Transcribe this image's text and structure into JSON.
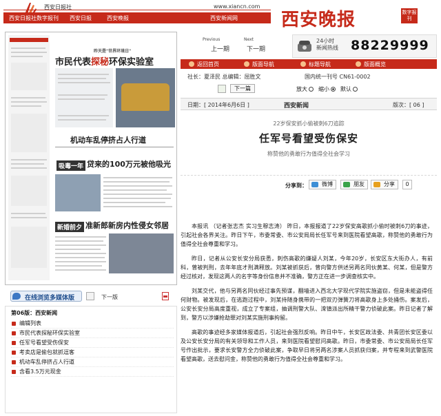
{
  "header": {
    "brand_small": "西安日报社",
    "url": "www.xiancn.com",
    "nav": [
      "西安日报社数字报刊",
      "西安日报",
      "西安晚报",
      "西安新闻网"
    ],
    "brand_title": "西安晚报",
    "brand_badge": "数字报刊",
    "accent_color": "#c62a1a"
  },
  "left_page": {
    "kicker": "昨天是\"世界环境日\"",
    "headline_main_a": "市民代表",
    "headline_main_accent": "探秘",
    "headline_main_b": "环保实验室",
    "headline_2": "机动车乱停挤占人行道",
    "headline_3_tag": "吸毒一年",
    "headline_3": "贷来的100万元被他吸光",
    "headline_4_tag": "新婚前夕",
    "headline_4": "准新郎新房内性侵女邻居"
  },
  "media_bar": {
    "media_label": "在线浏览多媒体版",
    "next_page": "下一版",
    "pdf_icon": "pdf-icon"
  },
  "toc": {
    "section": "第06版：西安新闻",
    "items": [
      "编辑列表",
      "市民代表探秘环保实验室",
      "任军号看望受伤保安",
      "考卖店是偷包就抓逗客",
      "机动车乱停挤占人行道",
      "含看3.5万元现金"
    ]
  },
  "hotline": {
    "label_a": "24小时",
    "label_b": "新闻热线",
    "number": "88229999"
  },
  "prevnext": {
    "previous_small": "Previous",
    "previous_label": "上一期",
    "next_small": "Next",
    "next_label": "下一期"
  },
  "redbar": [
    "返回首页",
    "版面导航",
    "标题导航",
    "版面概览"
  ],
  "editorial": {
    "editor": "社长：夏泽民  总编辑：屈胜文",
    "issn": "国内统一刊号 CN61-0002"
  },
  "tools": {
    "next_button": "下一篇",
    "zoom_big": "放大",
    "zoom_small": "缩小",
    "zoom_default": "默认"
  },
  "dateline": {
    "date": "日期：[ 2014年6月6日 ]",
    "section": "西安新闻",
    "edition": "版次：[ 06 ]"
  },
  "article": {
    "pretitle": "22岁保安抓小偷被刺6刀追踪",
    "title": "任军号看望受伤保安",
    "subtitle": "称赞他的勇敢行为值得全社会学习",
    "share_label": "分享到：",
    "share_buttons": [
      "微博",
      "朋友",
      "分享"
    ],
    "share_count": "0",
    "paragraphs": [
      "本报讯 （记者张志杰 实习生穆志涛） 昨日，本报报道了22岁保安高歌抓小偷时被刺6刀的事迹，引起社会各界关注。昨日下午，市委常委、市公安局局长任军号来到医院看望高歌，称赞他的勇敢行为值得全社会尊重和学习。",
      "昨日，记者从公安长安分局获悉，刺伤高歌的嫌疑人刘某，今年20岁，长安区东大街办人，有前科，曾被判刑，去年年底才刑满释放。刘某被抓获后，曾向警方供述另两名同伙黄某、何某，但是警方经过核对，发现这两人的名字等身份信息并不准确，警方正在进一步调查核实中。",
      "刘某交代，他与另两名同伙经过事先预谋，翻墙进入西北大学现代学院实施盗窃，但是未能盗得任何财物。被发现后，在逃跑过程中，刘某持随身携带的一把双刃弹簧刀将高歌身上多处捅伤。案发后，公安长安分局高度重视，成立了专案组，抽调刑警大队、滦镇派出所精干警力侦破此案。昨日记者了解到，警方以涉嫌抢劫罪对刘某实施刑事拘留。",
      "高歌的事迹经多家媒体报道后，引起社会强烈反响。昨日中午，长安区政法委、共青团长安区委以及公安长安分局的有关领导和工作人员，来到医院看望慰问高歌。昨日，市委常委、市公安局局长任军号作出批示，要求长安警方全力侦破此案，争取早日将另两名涉案人员抓获归案，并专程来到武警医院看望高歌，送去慰问金，称赞他的勇敢行为值得全社会尊重和学习。"
    ]
  }
}
